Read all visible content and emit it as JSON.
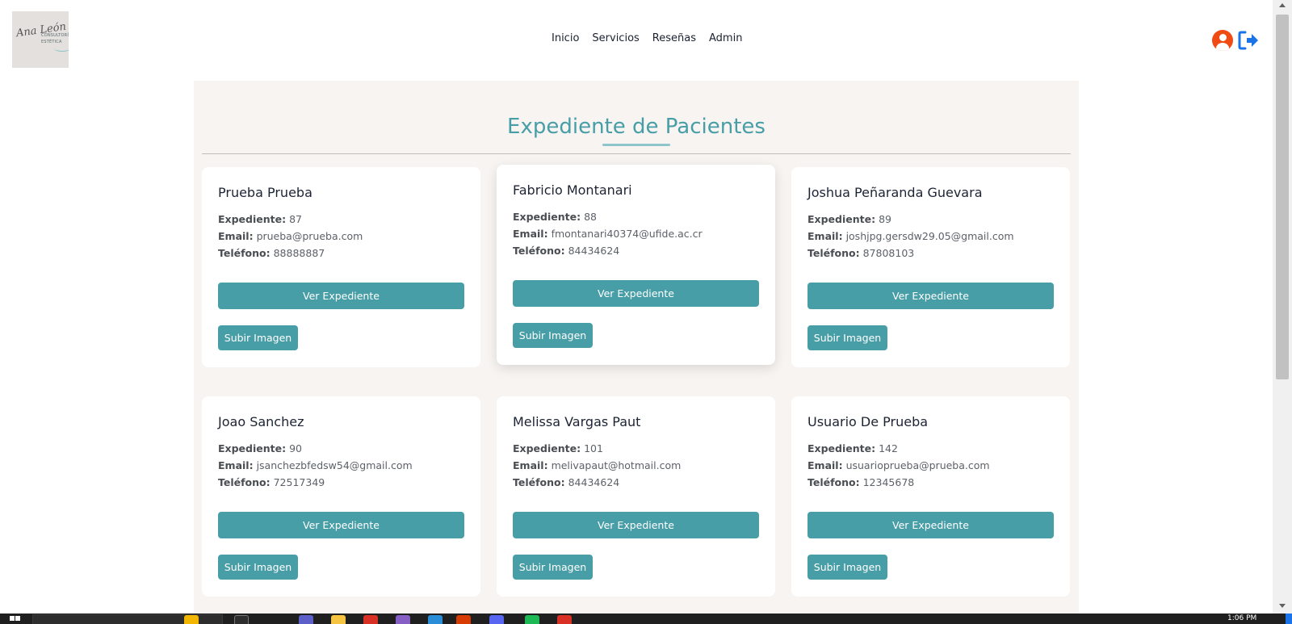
{
  "header": {
    "logo": {
      "script_text": "Ana León",
      "tagline_1": "CONSULTORÍA",
      "tagline_2": "ESTÉTICA"
    },
    "nav": [
      {
        "label": "Inicio"
      },
      {
        "label": "Servicios"
      },
      {
        "label": "Reseñas"
      },
      {
        "label": "Admin"
      }
    ],
    "icons": {
      "user": "user-circle-icon",
      "logout": "sign-out-icon"
    },
    "colors": {
      "user_icon": "#ef4b12",
      "logout_icon": "#1a73e8"
    }
  },
  "main": {
    "title": "Expediente de Pacientes",
    "labels": {
      "expediente": "Expediente:",
      "email": "Email:",
      "telefono": "Teléfono:"
    },
    "buttons": {
      "ver": "Ver Expediente",
      "subir": "Subir Imagen"
    },
    "patients": [
      {
        "name": "Prueba Prueba",
        "expediente": "87",
        "email": "prueba@prueba.com",
        "telefono": "88888887"
      },
      {
        "name": "Fabricio Montanari",
        "expediente": "88",
        "email": "fmontanari40374@ufide.ac.cr",
        "telefono": "84434624"
      },
      {
        "name": "Joshua Peñaranda Guevara",
        "expediente": "89",
        "email": "joshjpg.gersdw29.05@gmail.com",
        "telefono": "87808103"
      },
      {
        "name": "Joao Sanchez",
        "expediente": "90",
        "email": "jsanchezbfedsw54@gmail.com",
        "telefono": "72517349"
      },
      {
        "name": "Melissa Vargas Paut",
        "expediente": "101",
        "email": "melivapaut@hotmail.com",
        "telefono": "84434624"
      },
      {
        "name": "Usuario De Prueba",
        "expediente": "142",
        "email": "usuarioprueba@prueba.com",
        "telefono": "12345678"
      }
    ]
  },
  "colors": {
    "accent": "#489ea7",
    "panel_bg": "#f7f4f1",
    "text_dark": "#1c2333"
  },
  "taskbar": {
    "clock": "1:06 PM"
  }
}
